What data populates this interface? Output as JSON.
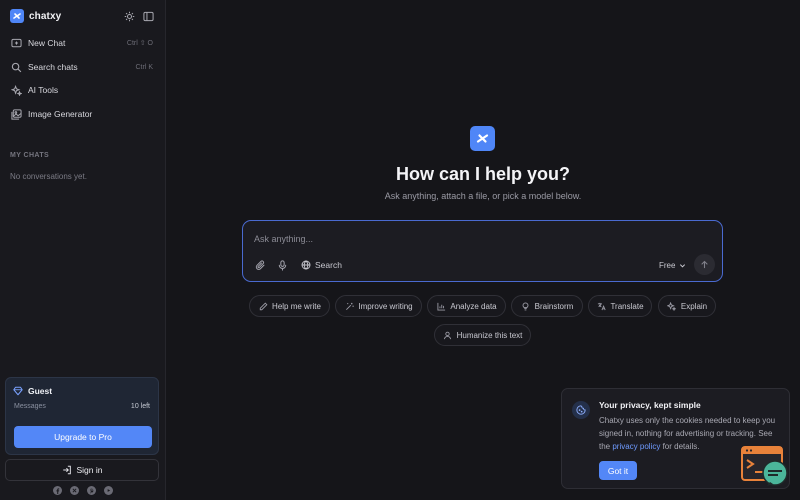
{
  "brand": {
    "name": "chatxy",
    "accent": "#4f86f7"
  },
  "sidebar": {
    "nav": [
      {
        "label": "New Chat",
        "shortcut": "Ctrl ⇧ O",
        "icon": "new-chat-icon"
      },
      {
        "label": "Search chats",
        "shortcut": "Ctrl K",
        "icon": "search-icon"
      },
      {
        "label": "AI Tools",
        "shortcut": "",
        "icon": "sparkles-icon"
      },
      {
        "label": "Image Generator",
        "shortcut": "",
        "icon": "image-icon"
      }
    ],
    "section_title": "MY CHATS",
    "empty_text": "No conversations yet."
  },
  "guest": {
    "name": "Guest",
    "messages_label": "Messages",
    "messages_left": "10 left",
    "upgrade_label": "Upgrade to Pro"
  },
  "signin_label": "Sign in",
  "socials": [
    "facebook-icon",
    "x-icon",
    "pinterest-icon",
    "youtube-icon"
  ],
  "hero": {
    "title": "How can I help you?",
    "subtitle": "Ask anything, attach a file, or pick a model below."
  },
  "composer": {
    "placeholder": "Ask anything...",
    "search_label": "Search",
    "model_label": "Free"
  },
  "chips": [
    {
      "label": "Help me write",
      "icon": "pencil-icon"
    },
    {
      "label": "Improve writing",
      "icon": "wand-icon"
    },
    {
      "label": "Analyze data",
      "icon": "bar-chart-icon"
    },
    {
      "label": "Brainstorm",
      "icon": "lightbulb-icon"
    },
    {
      "label": "Translate",
      "icon": "translate-icon"
    },
    {
      "label": "Explain",
      "icon": "sparkles-icon"
    },
    {
      "label": "Humanize this text",
      "icon": "person-icon"
    }
  ],
  "privacy": {
    "title": "Your privacy, kept simple",
    "body_before": "Chatxy uses only the cookies needed to keep you signed in, nothing for advertising or tracking. See the ",
    "link": "privacy policy",
    "body_after": " for details.",
    "button": "Got it"
  }
}
